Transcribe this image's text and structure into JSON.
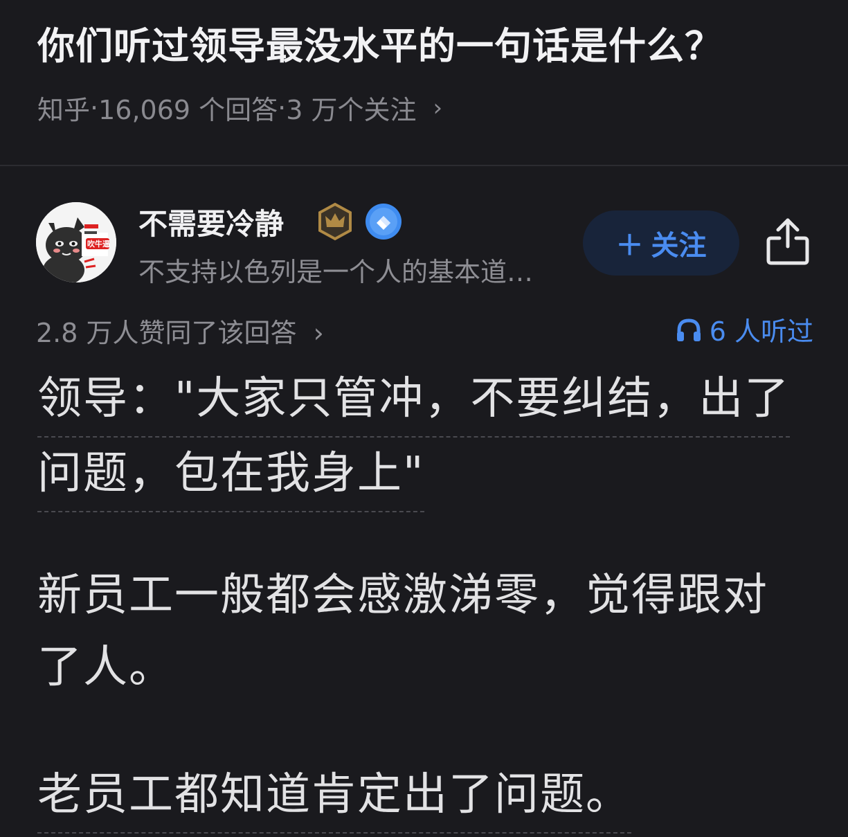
{
  "question": {
    "title": "你们听过领导最没水平的一句话是什么？",
    "source": "知乎",
    "answers": "16,069 个回答",
    "followers": "3 万个关注",
    "sep": " · ",
    "chevron": "›"
  },
  "author": {
    "name": "不需要冷静",
    "bio": "不支持以色列是一个人的基本道…",
    "avatar_icon": "black-cat-avatar-icon",
    "follow_label": "＋ 关注",
    "badges": [
      "crown-badge-icon",
      "verified-badge-icon"
    ]
  },
  "answer_meta": {
    "votes": "2.8 万人赞同了该回答",
    "chevron": "›",
    "listened": "6 人听过",
    "listened_icon": "headphones-icon"
  },
  "answer": {
    "p1_line1": "领导：\"大家只管冲，不要纠结，出了",
    "p1_line2": "问题，包在我身上\"",
    "p2_line1": "新员工一般都会感激涕零，觉得跟对",
    "p2_line2": "了人。",
    "p3_line1": "老员工都知道肯定出了问题。"
  },
  "colors": {
    "background": "#1a1a1e",
    "accent": "#4a8cf0",
    "muted": "#8e8e94"
  }
}
